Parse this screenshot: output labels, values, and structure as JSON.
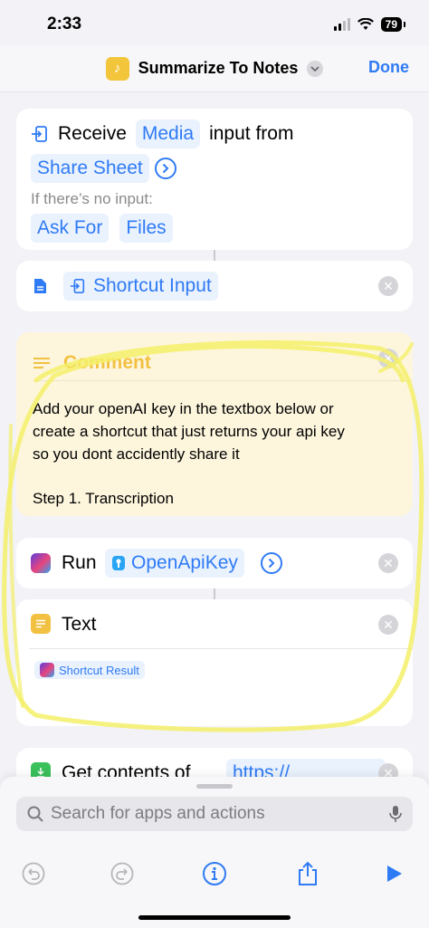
{
  "status": {
    "time": "2:33",
    "battery": "79"
  },
  "nav": {
    "title": "Summarize To Notes",
    "done": "Done"
  },
  "receive": {
    "word": "Receive",
    "media": "Media",
    "input_from": "input from",
    "source": "Share Sheet",
    "no_input_label": "If there’s no input:",
    "ask_for": "Ask For",
    "files": "Files"
  },
  "shortcut_input": {
    "label": "Shortcut Input"
  },
  "comment": {
    "title": "Comment",
    "line1": "Add your openAI key in the textbox below or",
    "line2": "create a shortcut that just returns your api key",
    "line3": "so you dont accidently share it",
    "line4": "Step 1. Transcription"
  },
  "run": {
    "word": "Run",
    "target": "OpenApiKey"
  },
  "text_action": {
    "title": "Text",
    "variable": "Shortcut Result"
  },
  "get_contents": {
    "label": "Get contents of",
    "url": "https://"
  },
  "search": {
    "placeholder": "Search for apps and actions"
  },
  "colors": {
    "accent": "#2f7bf5",
    "highlight": "#f4f06a",
    "comment_bg": "#fdf6dd"
  }
}
